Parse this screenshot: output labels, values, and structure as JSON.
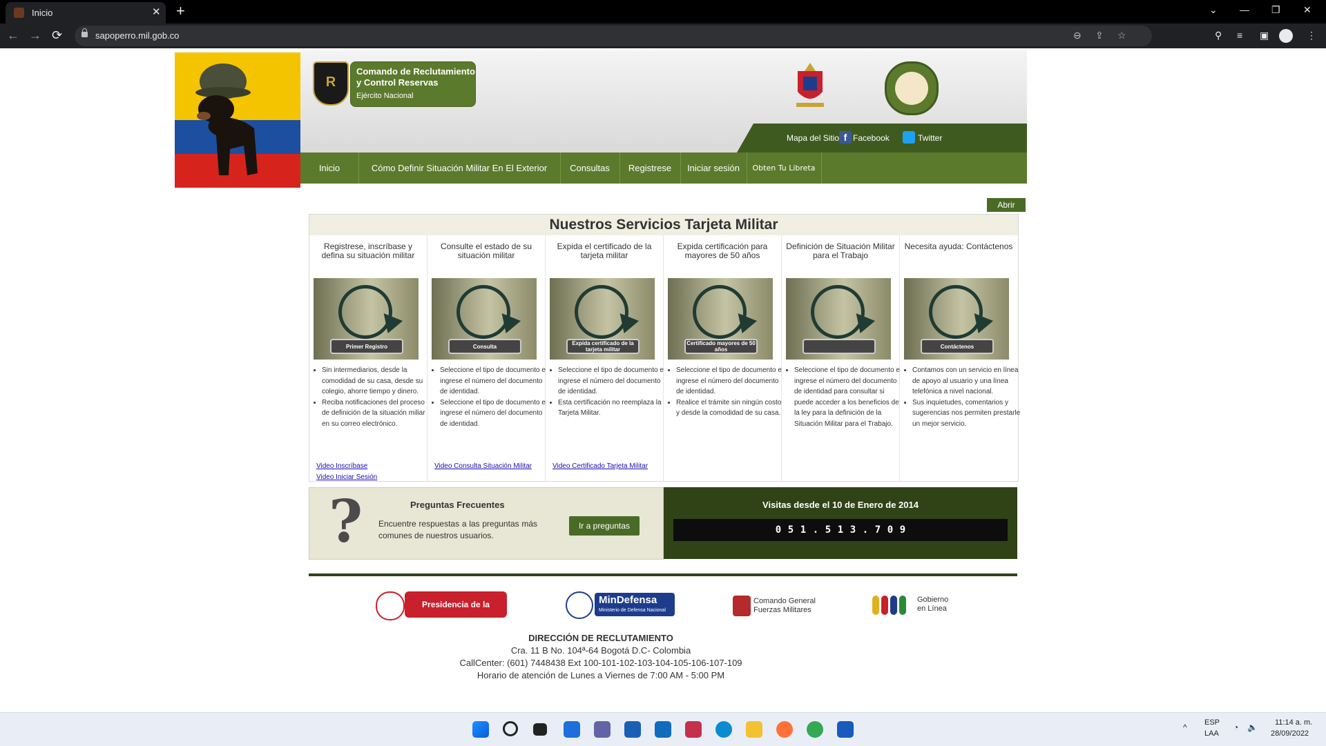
{
  "browser": {
    "tab_title": "Inicio",
    "tab_close": "✕",
    "new_tab": "+",
    "url": "sapoperro.mil.gob.co",
    "win_controls": [
      "⌄",
      "—",
      "❐",
      "✕"
    ],
    "nav": [
      "←",
      "→",
      "⟳"
    ],
    "omni_icons": [
      "⊖",
      "⇪",
      "☆"
    ],
    "toolbar_icons": [
      "⚲",
      "≡",
      "▣",
      "⋮"
    ]
  },
  "header": {
    "logo_initials": "R",
    "org_line1": "Comando de Reclutamiento",
    "org_line2": "y Control Reservas",
    "org_sub": "Ejército Nacional",
    "links": {
      "sitemap": "Mapa del Sitio",
      "facebook": "Facebook",
      "twitter": "Twitter",
      "fb_glyph": "f"
    }
  },
  "menu": [
    "Inicio",
    "Cómo Definir Situación Militar En El Exterior",
    "Consultas",
    "Registrese",
    "Iniciar sesión",
    "Obten Tu Libreta"
  ],
  "abrir": "Abrir",
  "services": {
    "title": "Nuestros Servicios Tarjeta Militar",
    "cols": [
      {
        "heading": "Registrese, inscríbase y defina su situación militar",
        "button": "Primer Registro",
        "bullets": [
          "Sin intermediarios, desde la comodidad de su casa, desde su colegio, ahorre tiempo y dinero.",
          "Reciba notificaciones del proceso de definición de la situación miliar en su correo electrónico."
        ],
        "links": [
          "Video Inscríbase",
          "Video Iniciar Sesión"
        ]
      },
      {
        "heading": "Consulte el estado de su situación militar",
        "button": "Consulta",
        "bullets": [
          "Seleccione el tipo de documento e ingrese el número del documento de identidad.",
          "Seleccione el tipo de documento e ingrese el número del documento de identidad."
        ],
        "links": [
          "Video Consulta Situación Militar"
        ]
      },
      {
        "heading": "Expida el certificado de la tarjeta militar",
        "button": "Expida certificado de la tarjeta militar",
        "bullets": [
          "Seleccione el tipo de documento e ingrese el número del documento de identidad.",
          "Esta certificación no reemplaza la Tarjeta Militar."
        ],
        "links": [
          "Video Certificado Tarjeta Militar"
        ]
      },
      {
        "heading": "Expida certificación para mayores de 50 años",
        "button": "Certificado mayores de 50 años",
        "bullets": [
          "Seleccione el tipo de documento e ingrese el número del documento de identidad.",
          "Realice el trámite sin ningún costo y desde la comodidad de su casa."
        ],
        "links": []
      },
      {
        "heading": "Definición de Situación Militar para el Trabajo",
        "button": "",
        "bullets": [
          "Seleccione el tipo de documento e ingrese el número del documento de identidad para consultar si puede acceder a los beneficios de la ley para la definición de la Situación Militar para el Trabajo."
        ],
        "links": []
      },
      {
        "heading": "Necesita ayuda: Contáctenos",
        "button": "Contáctenos",
        "bullets": [
          "Contamos con un servicio en línea de apoyo al usuario y una línea telefónica a nivel nacional.",
          "Sus inquietudes, comentarios y sugerencias nos permiten prestarle un mejor servicio."
        ],
        "links": []
      }
    ]
  },
  "faq": {
    "title": "Preguntas Frecuentes",
    "desc": "Encuentre respuestas a las preguntas más comunes de nuestros usuarios.",
    "button": "Ir a preguntas",
    "glyph": "?"
  },
  "visits": {
    "title": "Visitas desde el 10 de Enero de 2014",
    "digits": [
      "0",
      "5",
      "1",
      ".",
      "5",
      "1",
      "3",
      ".",
      "7",
      "0",
      "9"
    ]
  },
  "footer": {
    "presidencia": "Presidencia de la República",
    "mindefensa": "MinDefensa",
    "mindefensa_sub": "Ministerio de Defensa Nacional",
    "cgfm": "Comando General\nFuerzas Militares",
    "gobierno": "Gobierno\nen Línea",
    "address_title": "DIRECCIÓN DE RECLUTAMIENTO",
    "address": "Cra. 11 B No. 104ª-64 Bogotá D.C- Colombia",
    "callcenter": "CallCenter: (601) 7448438 Ext 100-101-102-103-104-105-106-107-109",
    "horario": "Horario de atención de Lunes a Viernes de 7:00 AM - 5:00 PM"
  },
  "taskbar": {
    "lang1": "ESP",
    "lang2": "LAA",
    "time": "11:14 a. m.",
    "date": "28/09/2022",
    "tray_glyphs": [
      "^",
      "◔",
      "🔈"
    ]
  },
  "colors": {
    "green": "#5b7a2c",
    "dark_green": "#2f4317",
    "accent": "#4a6b26"
  }
}
